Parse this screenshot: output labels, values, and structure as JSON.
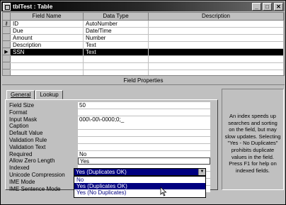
{
  "window": {
    "title": "tblTest : Table",
    "minimize_glyph": "_",
    "maximize_glyph": "□",
    "close_glyph": "✕",
    "icon": "table-icon"
  },
  "grid": {
    "headers": {
      "field_name": "Field Name",
      "data_type": "Data Type",
      "description": "Description"
    },
    "rows": [
      {
        "field_name": "ID",
        "data_type": "AutoNumber",
        "description": "",
        "key": true
      },
      {
        "field_name": "Due",
        "data_type": "Date/Time",
        "description": ""
      },
      {
        "field_name": "Amount",
        "data_type": "Number",
        "description": ""
      },
      {
        "field_name": "Description",
        "data_type": "Text",
        "description": ""
      },
      {
        "field_name": "SSN",
        "data_type": "Text",
        "description": "",
        "selected": true
      },
      {
        "field_name": "",
        "data_type": "",
        "description": ""
      },
      {
        "field_name": "",
        "data_type": "",
        "description": ""
      },
      {
        "field_name": "",
        "data_type": "",
        "description": ""
      }
    ]
  },
  "field_properties": {
    "header": "Field Properties",
    "tabs": [
      {
        "label": "General",
        "active": true
      },
      {
        "label": "Lookup",
        "active": false
      }
    ],
    "properties": [
      {
        "label": "Field Size",
        "value": "50"
      },
      {
        "label": "Format",
        "value": ""
      },
      {
        "label": "Input Mask",
        "value": "000\\-00\\-0000;0;_"
      },
      {
        "label": "Caption",
        "value": ""
      },
      {
        "label": "Default Value",
        "value": ""
      },
      {
        "label": "Validation Rule",
        "value": ""
      },
      {
        "label": "Validation Text",
        "value": ""
      },
      {
        "label": "Required",
        "value": "No"
      },
      {
        "label": "Allow Zero Length",
        "value": "Yes"
      },
      {
        "label": "Indexed",
        "value": "Yes (Duplicates OK)"
      },
      {
        "label": "Unicode Compression",
        "value": ""
      },
      {
        "label": "IME Mode",
        "value": ""
      },
      {
        "label": "IME Sentence Mode",
        "value": ""
      }
    ],
    "dropdown_options": [
      "No",
      "Yes (Duplicates OK)",
      "Yes (No Duplicates)"
    ],
    "dropdown_highlighted": "Yes (Duplicates OK)",
    "help_text": "An index speeds up searches and sorting on the field, but may slow updates. Selecting \"Yes - No Duplicates\" prohibits duplicate values in the field.  Press F1 for help on indexed fields."
  }
}
